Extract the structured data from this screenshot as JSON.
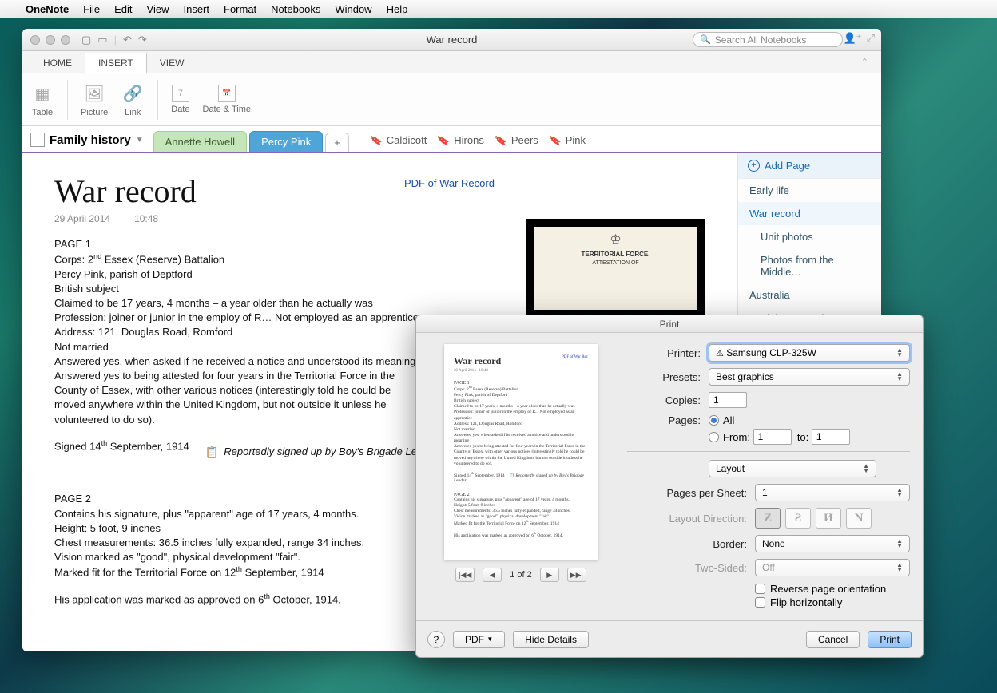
{
  "menubar": {
    "app": "OneNote",
    "items": [
      "File",
      "Edit",
      "View",
      "Insert",
      "Format",
      "Notebooks",
      "Window",
      "Help"
    ]
  },
  "window": {
    "title": "War record",
    "search_placeholder": "Search All Notebooks"
  },
  "ribbon_tabs": [
    "HOME",
    "INSERT",
    "VIEW"
  ],
  "ribbon_active": "INSERT",
  "ribbon_items": [
    {
      "label": "Table"
    },
    {
      "label": "Picture"
    },
    {
      "label": "Link"
    },
    {
      "label": "Date"
    },
    {
      "label": "Date & Time"
    }
  ],
  "notebook": {
    "name": "Family history"
  },
  "sections": [
    {
      "label": "Annette Howell",
      "style": "green"
    },
    {
      "label": "Percy Pink",
      "style": "blue",
      "active": true
    }
  ],
  "quicknotes": [
    "Caldicott",
    "Hirons",
    "Peers",
    "Pink"
  ],
  "page": {
    "title": "War record",
    "date": "29 April 2014",
    "time": "10:48",
    "pdf_link": "PDF of War Record",
    "body": {
      "p1_header": "PAGE 1",
      "p1_lines": [
        "Corps: 2nd Essex (Reserve) Battalion",
        "Percy Pink, parish of Deptford",
        "British subject",
        "Claimed to be 17 years, 4 months – a year older than he actually was",
        "Profession: joiner or junior in  the employ of R…   Not employed as an apprentice",
        "Address: 121, Douglas Road, Romford",
        "Not married",
        "Answered yes, when asked if he received  a notice and understood its meaning",
        "Answered yes to being attested for four years in the Territorial Force in the County of Essex, with other various notices (interestingly told he could be moved anywhere within the United Kingdom, but not outside it unless he volunteered to do so)."
      ],
      "signed": "Signed 14th September, 1914",
      "note": "Reportedly signed up by Boy's Brigade Leader",
      "p2_header": "PAGE 2",
      "p2_lines": [
        "Contains his signature, plus \"apparent\" age of 17 years, 4 months.",
        "Height:  5 foot, 9 inches",
        "Chest measurements: 36.5 inches fully expanded, range 34 inches.",
        "Vision marked as \"good\", physical development \"fair\".",
        "Marked fit for the Territorial Force on 12th September, 1914"
      ],
      "approved": "His application was marked as approved on 6th October, 1914."
    }
  },
  "pages_panel": {
    "add": "Add Page",
    "items": [
      {
        "label": "Early life"
      },
      {
        "label": "War record",
        "selected": true
      },
      {
        "label": "Unit photos",
        "sub": true
      },
      {
        "label": "Photos from the Middle…",
        "sub": true
      },
      {
        "label": "Australia"
      },
      {
        "label": "Back home again - worki…"
      }
    ]
  },
  "print": {
    "title": "Print",
    "labels": {
      "printer": "Printer:",
      "presets": "Presets:",
      "copies": "Copies:",
      "pages": "Pages:",
      "all": "All",
      "from": "From:",
      "to": "to:",
      "layout": "Layout",
      "pps": "Pages per Sheet:",
      "ld": "Layout Direction:",
      "border": "Border:",
      "twosided": "Two-Sided:",
      "reverse": "Reverse page orientation",
      "flip": "Flip horizontally"
    },
    "values": {
      "printer": "Samsung CLP-325W",
      "presets": "Best graphics",
      "copies": "1",
      "from": "1",
      "to": "1",
      "pps": "1",
      "border": "None",
      "twosided": "Off"
    },
    "nav": {
      "page_of": "1 of 2"
    },
    "buttons": {
      "pdf": "PDF",
      "hide": "Hide Details",
      "cancel": "Cancel",
      "print": "Print"
    },
    "preview_title": "War record"
  }
}
